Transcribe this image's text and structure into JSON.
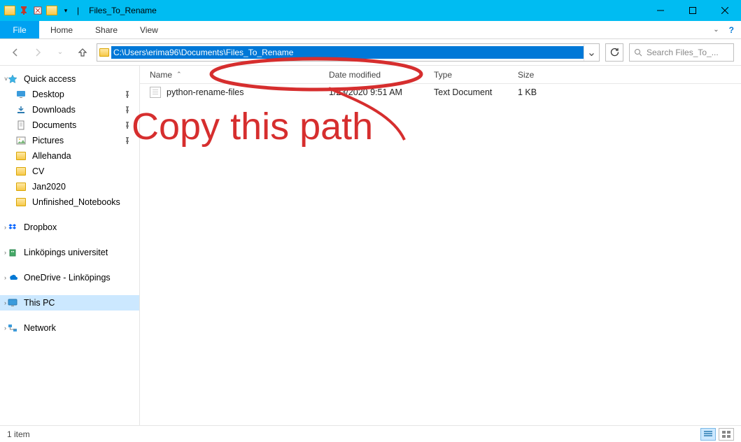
{
  "window": {
    "title": "Files_To_Rename"
  },
  "ribbon": {
    "file": "File",
    "tabs": [
      "Home",
      "Share",
      "View"
    ]
  },
  "address": {
    "path": "C:\\Users\\erima96\\Documents\\Files_To_Rename"
  },
  "search": {
    "placeholder": "Search Files_To_..."
  },
  "columns": {
    "name": "Name",
    "date": "Date modified",
    "type": "Type",
    "size": "Size"
  },
  "files": [
    {
      "name": "python-rename-files",
      "date": "1/23/2020 9:51 AM",
      "type": "Text Document",
      "size": "1 KB"
    }
  ],
  "sidebar": {
    "quick_access": "Quick access",
    "quick_items": [
      {
        "label": "Desktop",
        "icon": "desktop",
        "pinned": true
      },
      {
        "label": "Downloads",
        "icon": "downloads",
        "pinned": true
      },
      {
        "label": "Documents",
        "icon": "documents",
        "pinned": true
      },
      {
        "label": "Pictures",
        "icon": "pictures",
        "pinned": true
      },
      {
        "label": "Allehanda",
        "icon": "folder",
        "pinned": false
      },
      {
        "label": "CV",
        "icon": "folder",
        "pinned": false
      },
      {
        "label": "Jan2020",
        "icon": "folder",
        "pinned": false
      },
      {
        "label": "Unfinished_Notebooks",
        "icon": "folder",
        "pinned": false
      }
    ],
    "dropbox": "Dropbox",
    "liu": "Linköpings universitet",
    "onedrive": "OneDrive - Linköpings",
    "this_pc": "This PC",
    "network": "Network"
  },
  "status": {
    "count": "1 item"
  },
  "annotation": {
    "text": "Copy this path"
  }
}
